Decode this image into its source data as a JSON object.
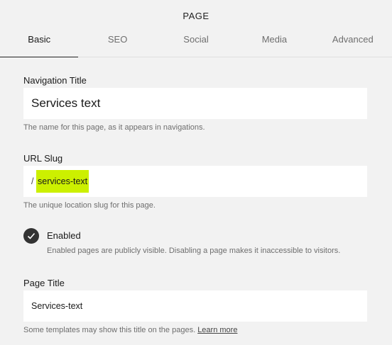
{
  "header": {
    "title": "PAGE"
  },
  "tabs": [
    {
      "label": "Basic",
      "active": true
    },
    {
      "label": "SEO",
      "active": false
    },
    {
      "label": "Social",
      "active": false
    },
    {
      "label": "Media",
      "active": false
    },
    {
      "label": "Advanced",
      "active": false
    }
  ],
  "navigation_title": {
    "label": "Navigation Title",
    "value": "Services text",
    "help": "The name for this page, as it appears in navigations."
  },
  "url_slug": {
    "label": "URL Slug",
    "prefix": "/",
    "value": "services-text",
    "help": "The unique location slug for this page."
  },
  "enabled": {
    "checked": true,
    "label": "Enabled",
    "description": "Enabled pages are publicly visible. Disabling a page makes it inaccessible to visitors."
  },
  "page_title": {
    "label": "Page Title",
    "value": "Services-text",
    "help": "Some templates may show this title on the pages.",
    "help_link": "Learn more"
  },
  "colors": {
    "background": "#f2f2f2",
    "slug_highlight": "#ccf000",
    "checkbox": "#333333"
  },
  "icons": {
    "enabled_check": "checkmark-icon"
  }
}
